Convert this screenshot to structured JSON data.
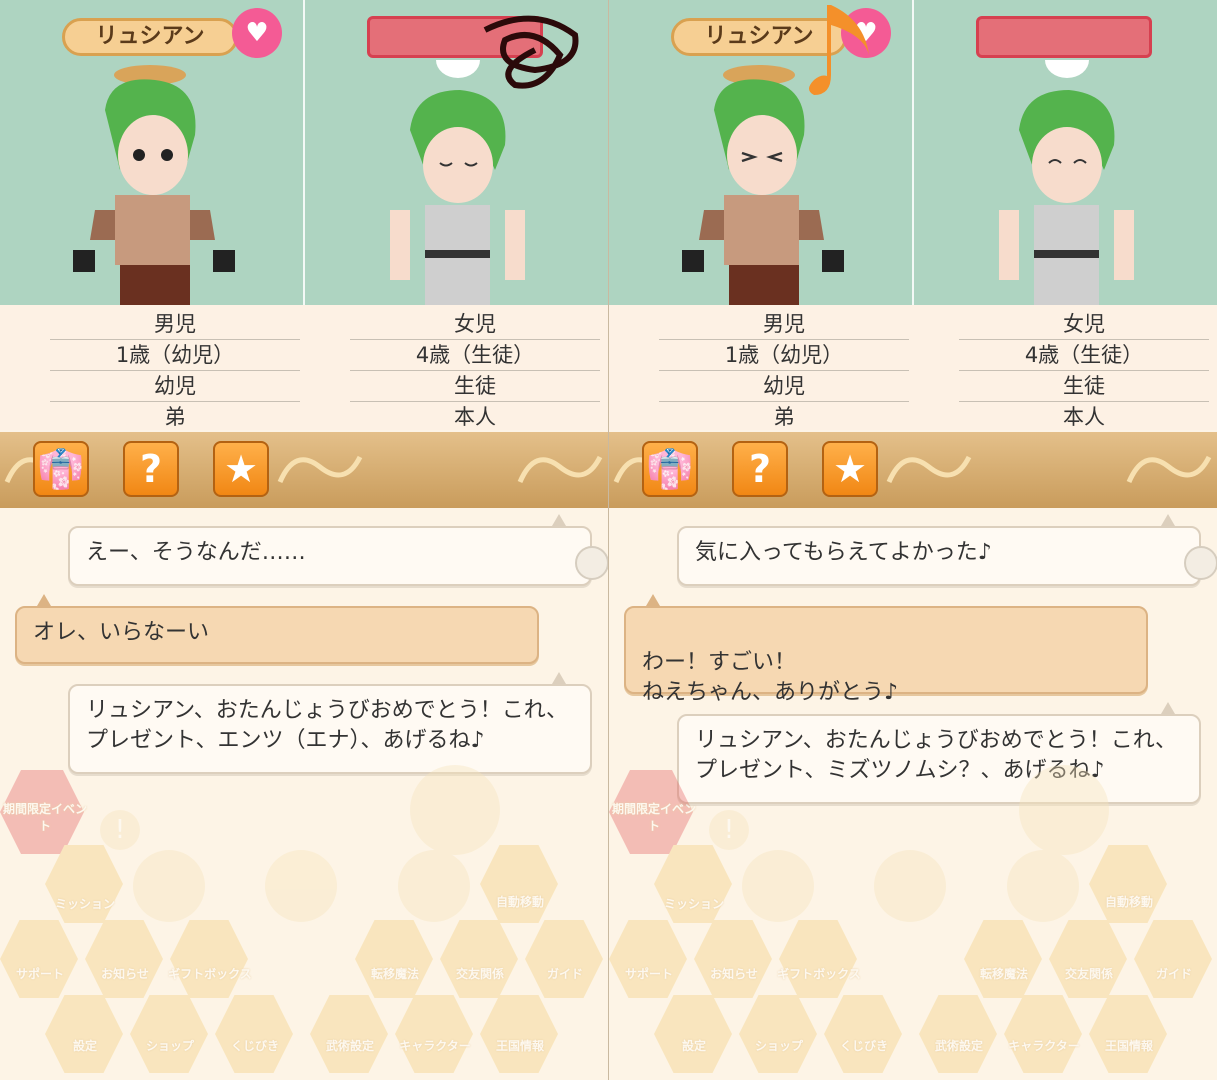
{
  "panels": [
    {
      "name_left": "リュシアン",
      "info_left": [
        "男児",
        "1歳（幼児）",
        "幼児",
        "弟"
      ],
      "info_right": [
        "女児",
        "4歳（生徒）",
        "生徒",
        "本人"
      ],
      "messages": [
        {
          "speaker": "right",
          "text": "えー、そうなんだ……"
        },
        {
          "speaker": "left",
          "text": "オレ、いらなーい"
        },
        {
          "speaker": "right",
          "text": "リュシアン、おたんじょうびおめでとう！これ、プレゼント、エンツ（エナ）、あげるね♪"
        }
      ]
    },
    {
      "name_left": "リュシアン",
      "info_left": [
        "男児",
        "1歳（幼児）",
        "幼児",
        "弟"
      ],
      "info_right": [
        "女児",
        "4歳（生徒）",
        "生徒",
        "本人"
      ],
      "messages": [
        {
          "speaker": "right",
          "text": "気に入ってもらえてよかった♪"
        },
        {
          "speaker": "left",
          "text": "わー！すごい！\nねえちゃん、ありがとう♪"
        },
        {
          "speaker": "right",
          "text": "リュシアン、おたんじょうびおめでとう！これ、プレゼント、ミズツノムシ？、あげるね♪"
        }
      ]
    }
  ],
  "toolbar": {
    "buttons": [
      {
        "icon": "coat-icon",
        "glyph": "👘"
      },
      {
        "icon": "question-icon",
        "glyph": "?"
      },
      {
        "icon": "star-icon",
        "glyph": "★"
      }
    ]
  },
  "menu": {
    "event_badge": "期間限定イベント",
    "alert_glyph": "!",
    "items": [
      "ミッション",
      "自動移動",
      "サポート",
      "お知らせ",
      "ギフトボックス",
      "転移魔法",
      "交友関係",
      "ガイド",
      "設定",
      "ショップ",
      "くじびき",
      "武術設定",
      "キャラクター",
      "王国情報"
    ]
  },
  "colors": {
    "background_top": "#aed4c1",
    "name_pill": "#f6cf93",
    "heart": "#f45b95",
    "orange_button": "#f18714",
    "tan_bubble": "#f6d8b2"
  }
}
